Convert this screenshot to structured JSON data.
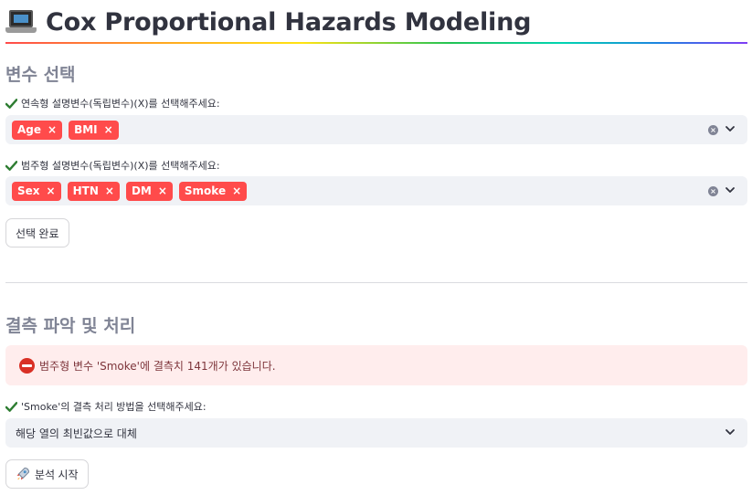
{
  "header": {
    "title": "Cox Proportional Hazards Modeling",
    "icon": "laptop-icon"
  },
  "variable_section": {
    "heading": "변수 선택",
    "continuous": {
      "label": "연속형 설명변수(독립변수)(X)를 선택해주세요:",
      "selected": [
        "Age",
        "BMI"
      ]
    },
    "categorical": {
      "label": "범주형 설명변수(독립변수)(X)를 선택해주세요:",
      "selected": [
        "Sex",
        "HTN",
        "DM",
        "Smoke"
      ]
    },
    "confirm_button": "선택 완료"
  },
  "missing_section": {
    "heading": "결측 파악 및 처리",
    "alert": "범주형 변수 'Smoke'에 결측치 141개가 있습니다.",
    "method_label": "'Smoke'의 결측 처리 방법을 선택해주세요:",
    "method_value": "해당 열의 최빈값으로 대체",
    "run_button": "분석 시작"
  },
  "colors": {
    "tag": "#ff4b4b",
    "input_bg": "#f0f2f6",
    "alert_bg": "#ffeded",
    "alert_text": "#7d353b",
    "check": "#2e7d32",
    "heading": "#808495"
  }
}
